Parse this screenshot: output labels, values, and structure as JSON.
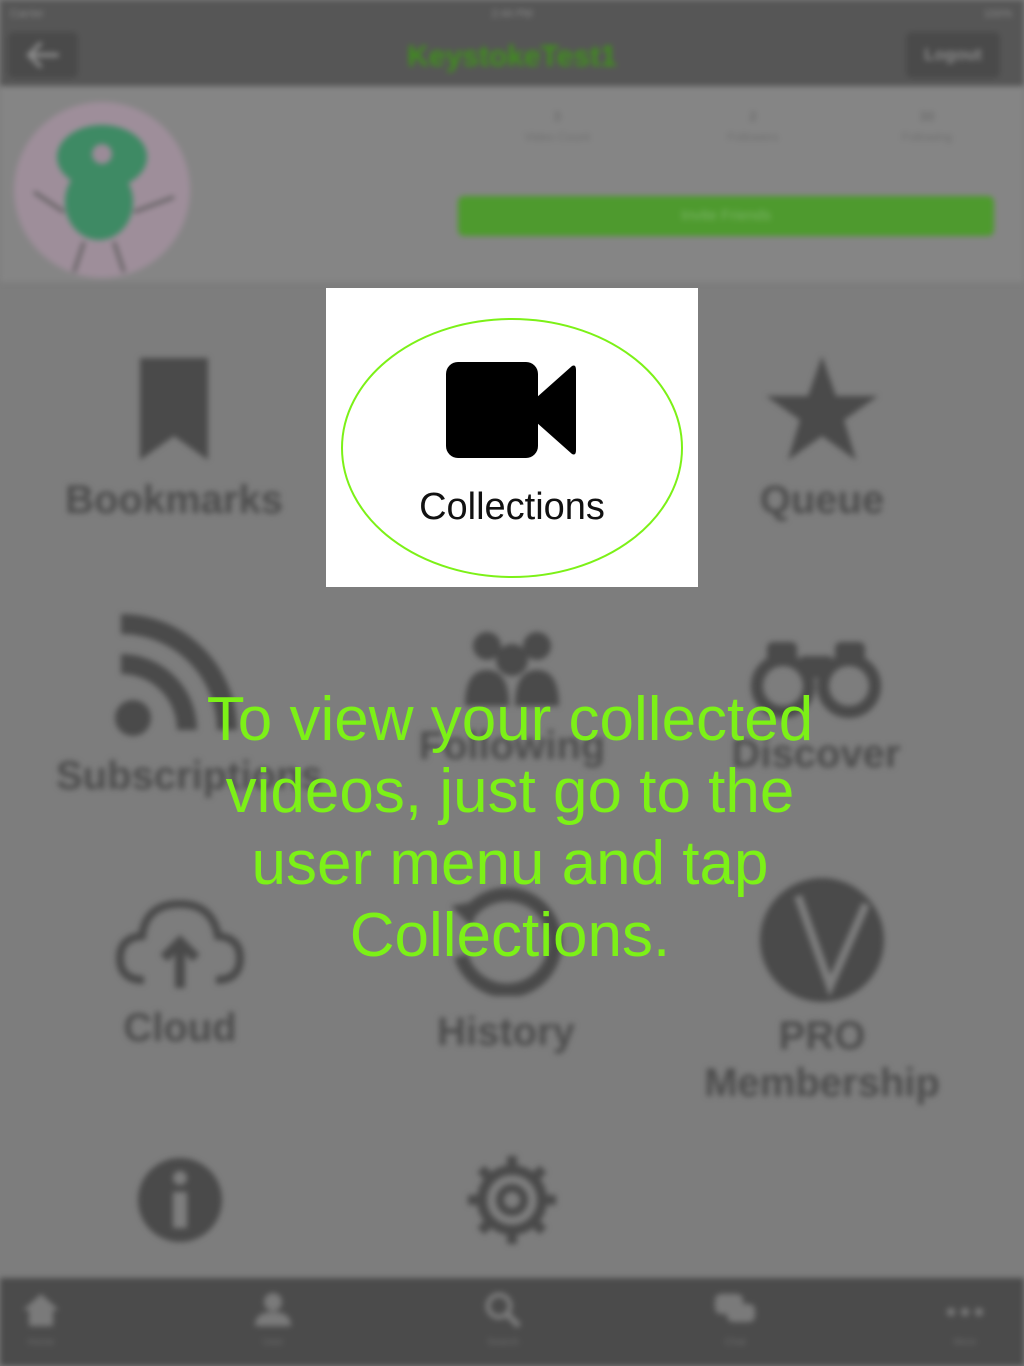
{
  "status_bar": {
    "carrier": "Carrier",
    "time": "2:44 PM",
    "battery": "100%"
  },
  "nav": {
    "title": "KeystokeTest1",
    "logout_label": "Logout"
  },
  "profile": {
    "stats": [
      {
        "value": "3",
        "label": "Video Count"
      },
      {
        "value": "2",
        "label": "Followers"
      },
      {
        "value": "30",
        "label": "Following"
      }
    ],
    "invite_label": "Invite Friends"
  },
  "menu": {
    "bookmarks": "Bookmarks",
    "queue": "Queue",
    "subscriptions": "Subscriptions",
    "following": "Following",
    "discover": "Discover",
    "cloud": "Cloud",
    "history": "History",
    "pro_line1": "PRO",
    "pro_line2": "Membership"
  },
  "tabs": [
    {
      "label": "Home",
      "icon": "home-icon"
    },
    {
      "label": "User",
      "icon": "user-icon"
    },
    {
      "label": "Search",
      "icon": "search-icon"
    },
    {
      "label": "Chat",
      "icon": "chat-icon"
    },
    {
      "label": "More",
      "icon": "more-icon"
    }
  ],
  "overlay": {
    "callout_label": "Collections",
    "message": "To view your collected videos, just go to the user menu and tap Collections."
  },
  "colors": {
    "accent_green": "#7cf117",
    "nav_bg": "#565656",
    "callout_ellipse": "#7cf117"
  }
}
